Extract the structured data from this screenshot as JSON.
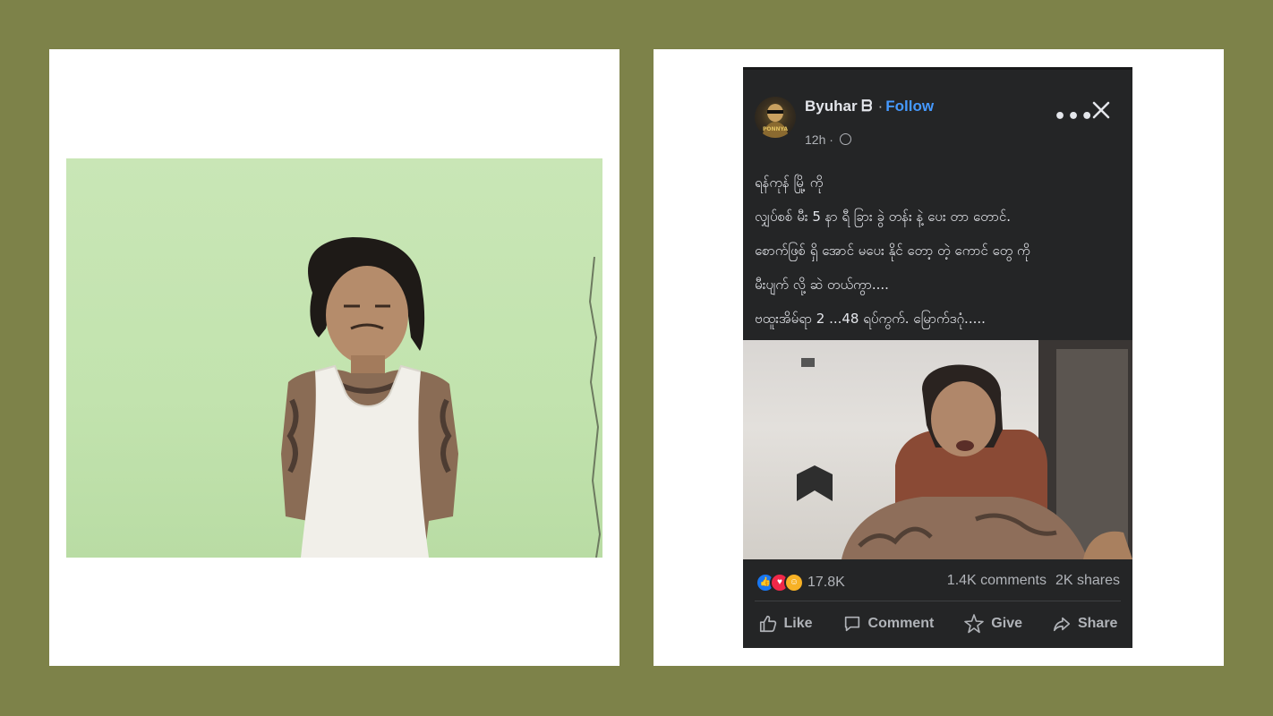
{
  "post": {
    "author": "Byuhar ᗷ",
    "separator": "·",
    "follow_label": "Follow",
    "time": "12h ·",
    "more_icon": "more-horizontal-icon",
    "close_icon": "close-icon",
    "avatar_text": "PONNYA",
    "lines": [
      "ရန်ကုန် မြို့ ကို",
      "လျှပ်စစ် မီး 5 နာ ရီ ခြား ခွဲ တန်း နဲ့ ပေး တာ တောင်.",
      " စောက်ဖြစ် ရှိ အောင် မပေး နိုင် တော့ တဲ့ ကောင် တွေ ကို",
      " မီးပျက် လို့ ဆဲ တယ်ကွာ....",
      "ဗထူးအိမ်ရာ 2 ...48 ရပ်ကွက်. မြောက်ဒဂုံ....."
    ],
    "reaction_count": "17.8K",
    "comments": "1.4K comments",
    "shares": "2K shares",
    "actions": {
      "like": "Like",
      "comment": "Comment",
      "give": "Give",
      "share": "Share"
    }
  },
  "colors": {
    "background": "#7d8249",
    "post_bg": "#242526",
    "link": "#4599ff",
    "text": "#e4e6eb",
    "muted": "#b0b3b8"
  }
}
